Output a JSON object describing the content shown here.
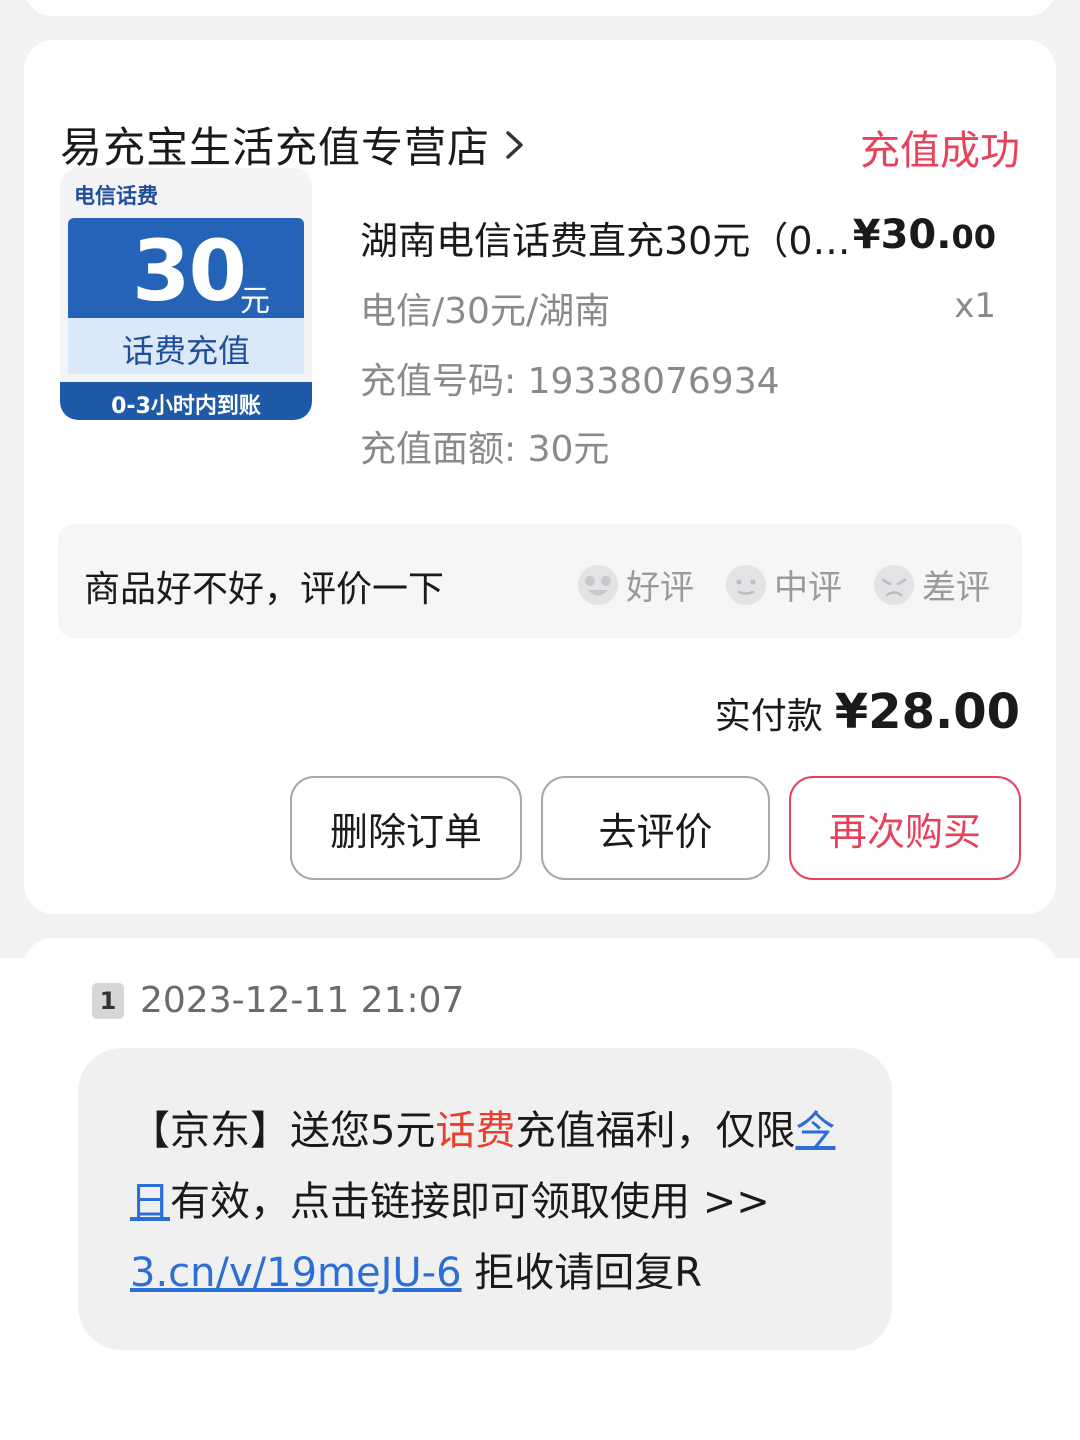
{
  "order": {
    "shop_name": "易充宝生活充值专营店",
    "status": "充值成功",
    "thumbnail": {
      "tag": "电信话费",
      "amount": "30",
      "unit": "元",
      "caption": "话费充值",
      "banner": "0-3小时内到账"
    },
    "product_title": "湖南电信话费直充30元（0…",
    "price_main": "¥30.",
    "price_cents": "00",
    "spec": "电信/30元/湖南",
    "quantity": "x1",
    "phone_line": "充值号码: 19338076934",
    "face_value_line": "充值面额: 30元",
    "review": {
      "prompt": "商品好不好，评价一下",
      "options": [
        {
          "label": "好评",
          "icon": "heart-eyes-face-icon"
        },
        {
          "label": "中评",
          "icon": "neutral-face-icon"
        },
        {
          "label": "差评",
          "icon": "frown-face-icon"
        }
      ]
    },
    "paid_label": "实付款",
    "paid_amount": "¥28.00",
    "buttons": {
      "delete": "删除订单",
      "review": "去评价",
      "rebuy": "再次购买"
    },
    "colors": {
      "accent": "#e8415b",
      "thumb_blue": "#2463b8",
      "link": "#2b6fd6"
    }
  },
  "sms": {
    "sim": "1",
    "time": "2023-12-11 21:07",
    "text": {
      "p1": "【京东】送您5元",
      "p2": "话费",
      "p3": "充值福利，仅限",
      "p4": "今日",
      "p5": "有效，点击链接即可领取使用 >> ",
      "link": "3.cn/v/19meJU-6",
      "p6": " 拒收请回复R"
    }
  }
}
